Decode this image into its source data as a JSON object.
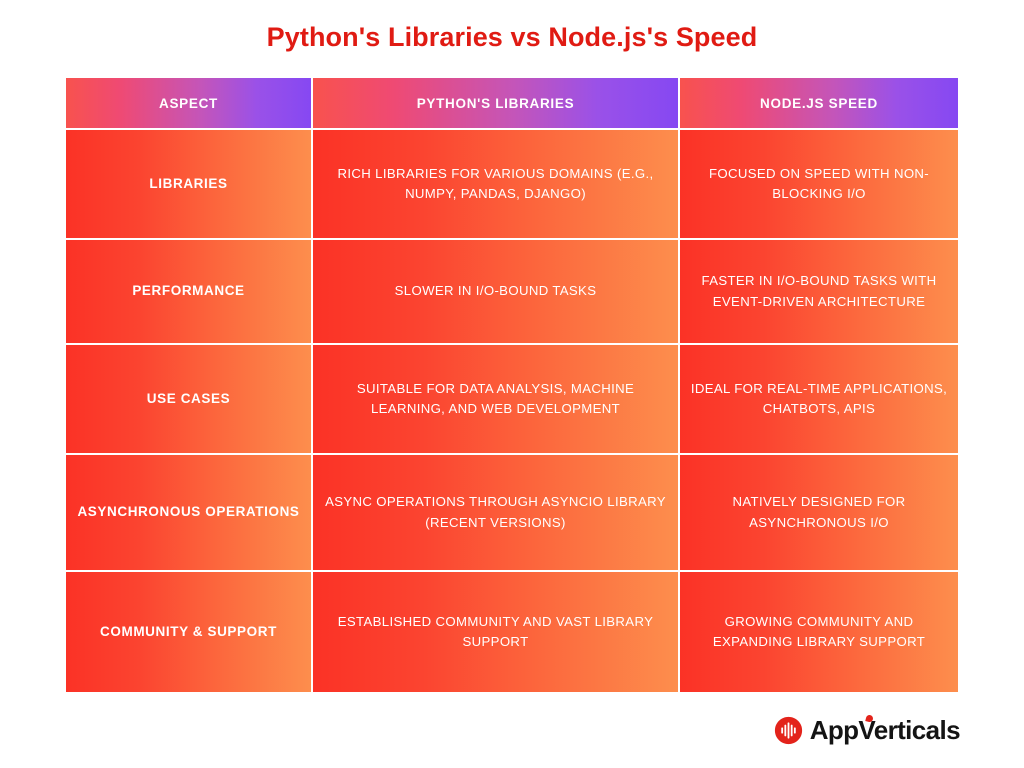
{
  "title": "Python's Libraries vs Node.js's Speed",
  "colors": {
    "title_red": "#e01b13",
    "header_gradient_start": "#f8524e",
    "header_gradient_end": "#8648f2",
    "body_gradient_start": "#fb3226",
    "body_gradient_end": "#fd8e4d",
    "cell_text": "#ffffff",
    "logo_red": "#e3231b",
    "logo_text": "#141414",
    "page_background": "#ffffff"
  },
  "table": {
    "columns": [
      "ASPECT",
      "PYTHON'S LIBRARIES",
      "NODE.JS SPEED"
    ],
    "rows": [
      {
        "aspect": "LIBRARIES",
        "python": "RICH LIBRARIES FOR VARIOUS DOMAINS (E.G., NUMPY, PANDAS, DJANGO)",
        "node": "FOCUSED ON SPEED WITH NON-BLOCKING I/O"
      },
      {
        "aspect": "PERFORMANCE",
        "python": "SLOWER IN I/O-BOUND TASKS",
        "node": "FASTER IN I/O-BOUND TASKS WITH EVENT-DRIVEN ARCHITECTURE"
      },
      {
        "aspect": "USE CASES",
        "python": "SUITABLE FOR DATA ANALYSIS, MACHINE LEARNING, AND WEB DEVELOPMENT",
        "node": "IDEAL FOR REAL-TIME APPLICATIONS, CHATBOTS, APIS"
      },
      {
        "aspect": "ASYNCHRONOUS OPERATIONS",
        "python": "ASYNC OPERATIONS THROUGH ASYNCIO LIBRARY (RECENT VERSIONS)",
        "node": "NATIVELY DESIGNED FOR ASYNCHRONOUS I/O"
      },
      {
        "aspect": "COMMUNITY & SUPPORT",
        "python": "ESTABLISHED COMMUNITY AND VAST LIBRARY SUPPORT",
        "node": "GROWING COMMUNITY AND EXPANDING LIBRARY SUPPORT"
      }
    ]
  },
  "logo": {
    "icon": "appverticals-bars-icon",
    "name": "AppVerticals"
  }
}
